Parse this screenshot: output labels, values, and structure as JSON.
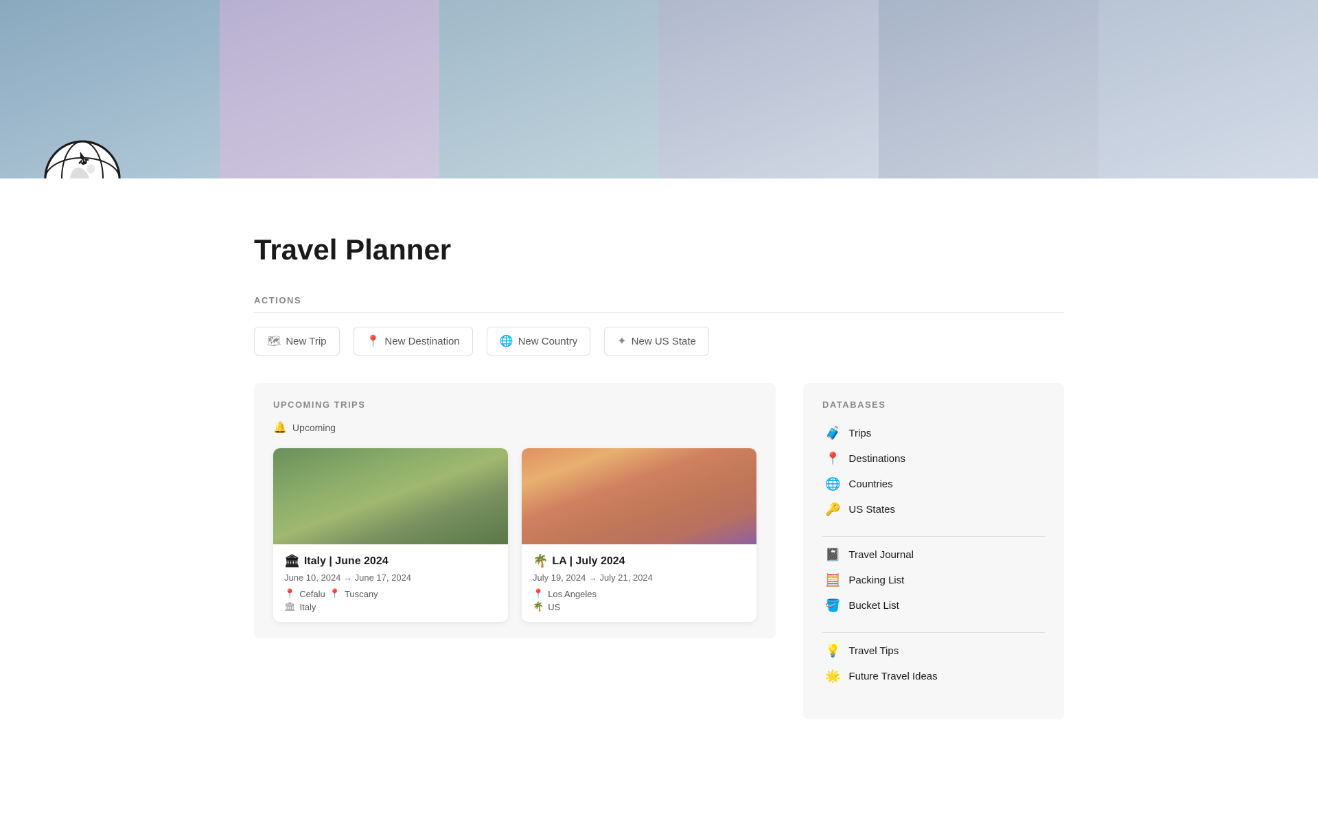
{
  "page": {
    "title": "Travel Planner"
  },
  "banner": {
    "photos": [
      "p1",
      "p2",
      "p3",
      "p4",
      "p5",
      "p6"
    ]
  },
  "actions": {
    "section_label": "ACTIONS",
    "buttons": [
      {
        "id": "new-trip",
        "icon": "🗺",
        "label": "New Trip"
      },
      {
        "id": "new-destination",
        "icon": "📍",
        "label": "New Destination"
      },
      {
        "id": "new-country",
        "icon": "🌐",
        "label": "New Country"
      },
      {
        "id": "new-us-state",
        "icon": "✦",
        "label": "New US State"
      }
    ]
  },
  "upcoming_trips": {
    "section_label": "UPCOMING TRIPS",
    "filter_label": "Upcoming",
    "filter_icon": "🔔",
    "trips": [
      {
        "id": "italy",
        "emoji": "🏛",
        "title": "Italy | June 2024",
        "dates": "June 10, 2024 → June 17, 2024",
        "destinations": [
          "Cefalu",
          "Tuscany"
        ],
        "country": "Italy",
        "img_class": "italy-img"
      },
      {
        "id": "la",
        "emoji": "🌴",
        "title": "LA | July 2024",
        "dates": "July 19, 2024 → July 21, 2024",
        "destinations": [
          "Los Angeles"
        ],
        "country": "US",
        "img_class": "la-img"
      }
    ]
  },
  "databases": {
    "section_label": "DATABASES",
    "groups": [
      {
        "items": [
          {
            "id": "trips",
            "icon": "🧳",
            "label": "Trips"
          },
          {
            "id": "destinations",
            "icon": "📍",
            "label": "Destinations"
          },
          {
            "id": "countries",
            "icon": "🌐",
            "label": "Countries"
          },
          {
            "id": "us-states",
            "icon": "🔑",
            "label": "US States"
          }
        ]
      },
      {
        "items": [
          {
            "id": "travel-journal",
            "icon": "📓",
            "label": "Travel Journal"
          },
          {
            "id": "packing-list",
            "icon": "🧮",
            "label": "Packing List"
          },
          {
            "id": "bucket-list",
            "icon": "🪣",
            "label": "Bucket List"
          }
        ]
      },
      {
        "items": [
          {
            "id": "travel-tips",
            "icon": "💡",
            "label": "Travel Tips"
          },
          {
            "id": "future-travel-ideas",
            "icon": "🌟",
            "label": "Future Travel Ideas"
          }
        ]
      }
    ]
  }
}
